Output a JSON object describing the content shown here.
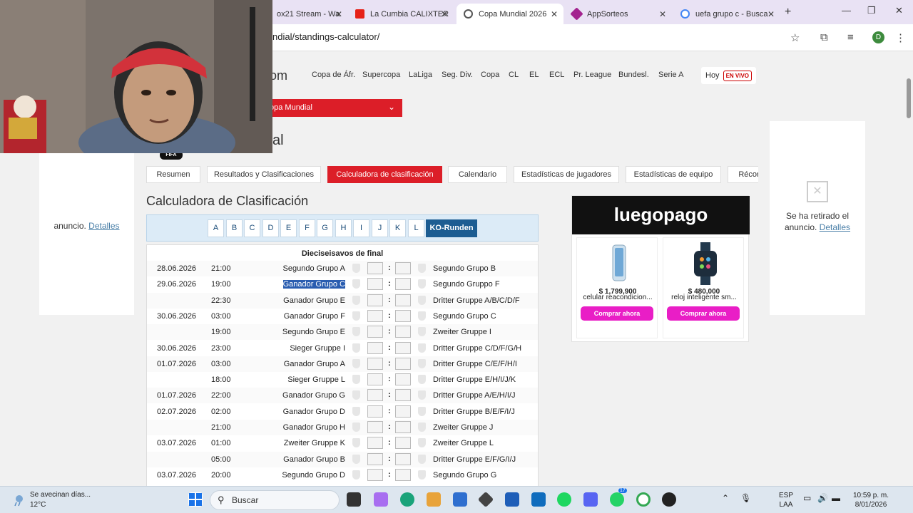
{
  "browser": {
    "tabs": [
      {
        "label": "ox21 Stream - Wa",
        "color": "#2a7d5f"
      },
      {
        "label": "La Cumbia CALIXTER",
        "color": "#e62117"
      },
      {
        "label": "Copa Mundial 2026",
        "color": "#555555"
      },
      {
        "label": "AppSorteos",
        "color": "#a3238f"
      },
      {
        "label": "uefa grupo c - Busca",
        "color": "#4285f4"
      }
    ],
    "url": "ndial/standings-calculator/",
    "profile_initial": "D"
  },
  "site": {
    "logo_tail": "om",
    "nav": [
      "Copa de Áfr.",
      "Supercopa",
      "LaLiga",
      "Seg. Div.",
      "Copa",
      "CL",
      "EL",
      "ECL",
      "Pr. League",
      "Bundesl.",
      "Serie A"
    ],
    "hoy_label": "Hoy",
    "live_badge": "EN VIVO",
    "competition_select": "opa Mundial",
    "title_tail": "al",
    "fifa_badge": "FIFA"
  },
  "ads": {
    "left_text": "anuncio.",
    "left_link": "Detalles",
    "right_text_1": "Se ha retirado el",
    "right_text_2": "anuncio.",
    "right_link": "Detalles",
    "banner": "luegopago",
    "products": [
      {
        "price": "$ 1,799,900",
        "name": "celular reacondicion...",
        "cta": "Comprar ahora"
      },
      {
        "price": "$ 480,000",
        "name": "reloj inteligente sm...",
        "cta": "Comprar ahora"
      }
    ]
  },
  "page_tabs": [
    "Resumen",
    "Resultados y Clasificaciones",
    "Calculadora de clasificación",
    "Calendario",
    "Estadísticas de jugadores",
    "Estadísticas de equipo",
    "Récor"
  ],
  "calculator": {
    "title": "Calculadora de Clasificación",
    "groups": [
      "A",
      "B",
      "C",
      "D",
      "E",
      "F",
      "G",
      "H",
      "I",
      "J",
      "K",
      "L"
    ],
    "ko_label": "KO-Runden",
    "round_title": "Dieciseisavos de final",
    "matches": [
      {
        "date": "28.06.2026",
        "time": "21:00",
        "home": "Segundo Grupo A",
        "away": "Segundo Grupo B"
      },
      {
        "date": "29.06.2026",
        "time": "19:00",
        "home": "Ganador Grupo C",
        "away": "Segundo Gruppo F"
      },
      {
        "date": "",
        "time": "22:30",
        "home": "Ganador Grupo E",
        "away": "Dritter Gruppe A/B/C/D/F"
      },
      {
        "date": "30.06.2026",
        "time": "03:00",
        "home": "Ganador Grupo F",
        "away": "Segundo Grupo C"
      },
      {
        "date": "",
        "time": "19:00",
        "home": "Segundo Grupo E",
        "away": "Zweiter Gruppe I"
      },
      {
        "date": "30.06.2026",
        "time": "23:00",
        "home": "Sieger Gruppe I",
        "away": "Dritter Gruppe C/D/F/G/H"
      },
      {
        "date": "01.07.2026",
        "time": "03:00",
        "home": "Ganador Grupo A",
        "away": "Dritter Gruppe C/E/F/H/I"
      },
      {
        "date": "",
        "time": "18:00",
        "home": "Sieger Gruppe L",
        "away": "Dritter Gruppe E/H/I/J/K"
      },
      {
        "date": "01.07.2026",
        "time": "22:00",
        "home": "Ganador Grupo G",
        "away": "Dritter Gruppe A/E/H/I/J"
      },
      {
        "date": "02.07.2026",
        "time": "02:00",
        "home": "Ganador Grupo D",
        "away": "Dritter Gruppe B/E/F/I/J"
      },
      {
        "date": "",
        "time": "21:00",
        "home": "Ganador Grupo H",
        "away": "Zweiter Gruppe J"
      },
      {
        "date": "03.07.2026",
        "time": "01:00",
        "home": "Zweiter Gruppe K",
        "away": "Zweiter Gruppe L"
      },
      {
        "date": "",
        "time": "05:00",
        "home": "Ganador Grupo B",
        "away": "Dritter Gruppe E/F/G/I/J"
      },
      {
        "date": "03.07.2026",
        "time": "20:00",
        "home": "Segundo Grupo D",
        "away": "Segundo Grupo G"
      }
    ]
  },
  "taskbar": {
    "weather_text": "Se avecinan días...",
    "temperature": "12°C",
    "search_placeholder": "Buscar",
    "lang_1": "ESP",
    "lang_2": "LAA",
    "time": "10:59 p. m.",
    "date": "8/01/2026",
    "badge_count": "17"
  }
}
